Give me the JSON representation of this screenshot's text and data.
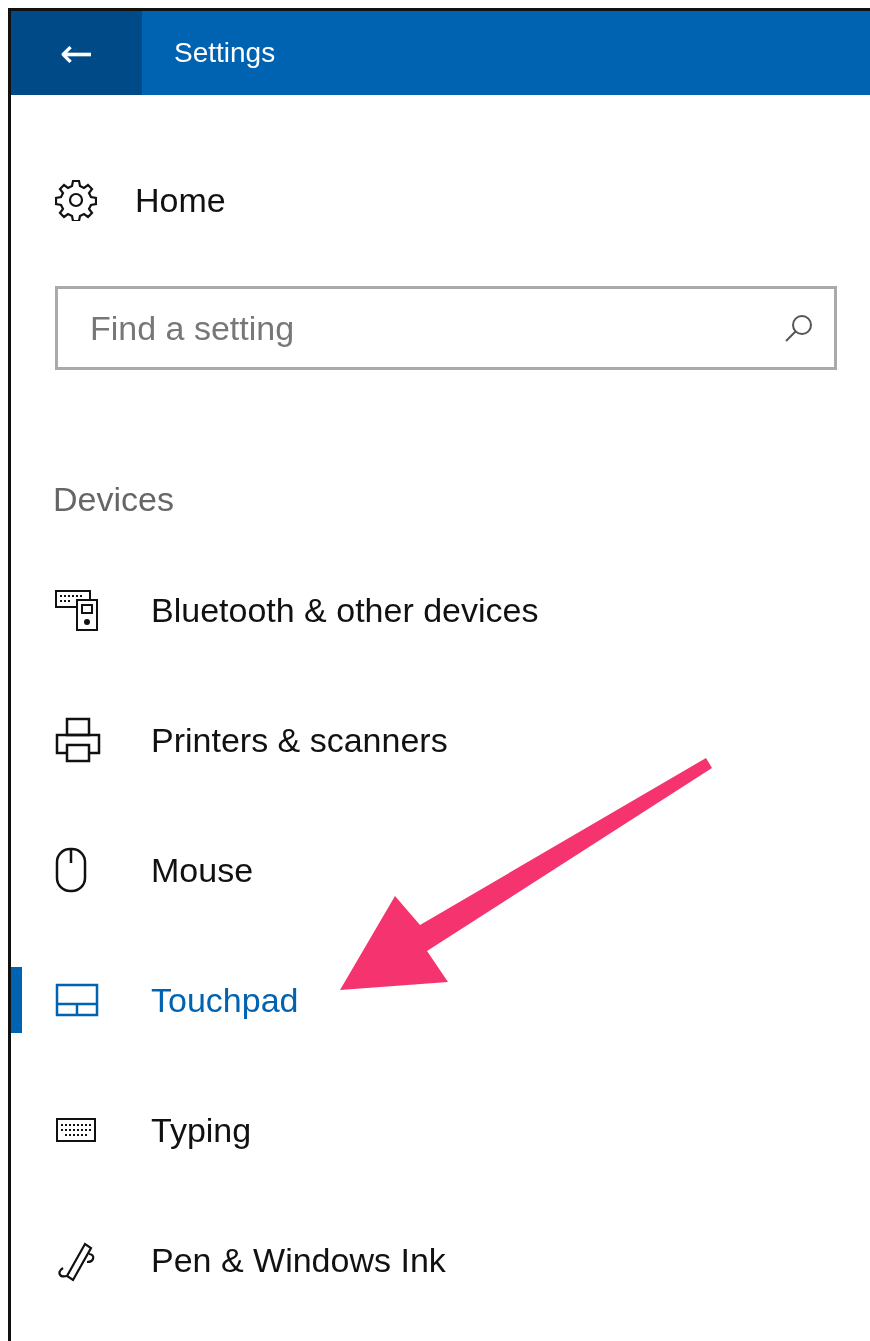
{
  "window": {
    "title": "Settings",
    "back": "←"
  },
  "home": {
    "label": "Home"
  },
  "search": {
    "placeholder": "Find a setting"
  },
  "section": {
    "title": "Devices"
  },
  "items": [
    {
      "kind": "bluetooth",
      "label": "Bluetooth & other devices",
      "selected": false
    },
    {
      "kind": "printer",
      "label": "Printers & scanners",
      "selected": false
    },
    {
      "kind": "mouse",
      "label": "Mouse",
      "selected": false
    },
    {
      "kind": "touchpad",
      "label": "Touchpad",
      "selected": true
    },
    {
      "kind": "keyboard",
      "label": "Typing",
      "selected": false
    },
    {
      "kind": "pen",
      "label": "Pen & Windows Ink",
      "selected": false
    }
  ]
}
